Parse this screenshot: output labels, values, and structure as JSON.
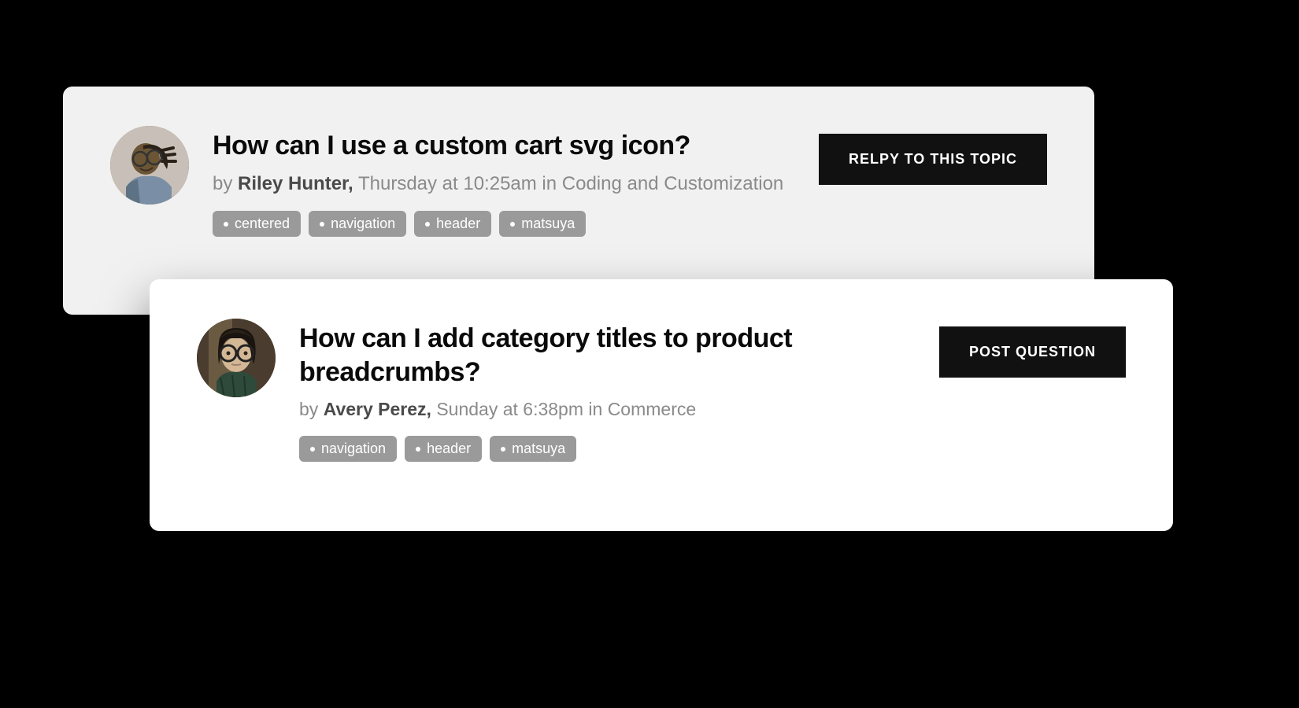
{
  "cards": [
    {
      "title": "How can I use a custom cart svg icon?",
      "by_label": "by ",
      "author": "Riley Hunter,",
      "meta_suffix": " Thursday at 10:25am in Coding and Customization",
      "button_label": "RELPY TO THIS TOPIC",
      "tags": [
        "centered",
        "navigation",
        "header",
        "matsuya"
      ]
    },
    {
      "title": "How can I add category titles to product breadcrumbs?",
      "by_label": "by ",
      "author": "Avery Perez,",
      "meta_suffix": " Sunday at 6:38pm in Commerce",
      "button_label": "POST QUESTION",
      "tags": [
        "navigation",
        "header",
        "matsuya"
      ]
    }
  ]
}
